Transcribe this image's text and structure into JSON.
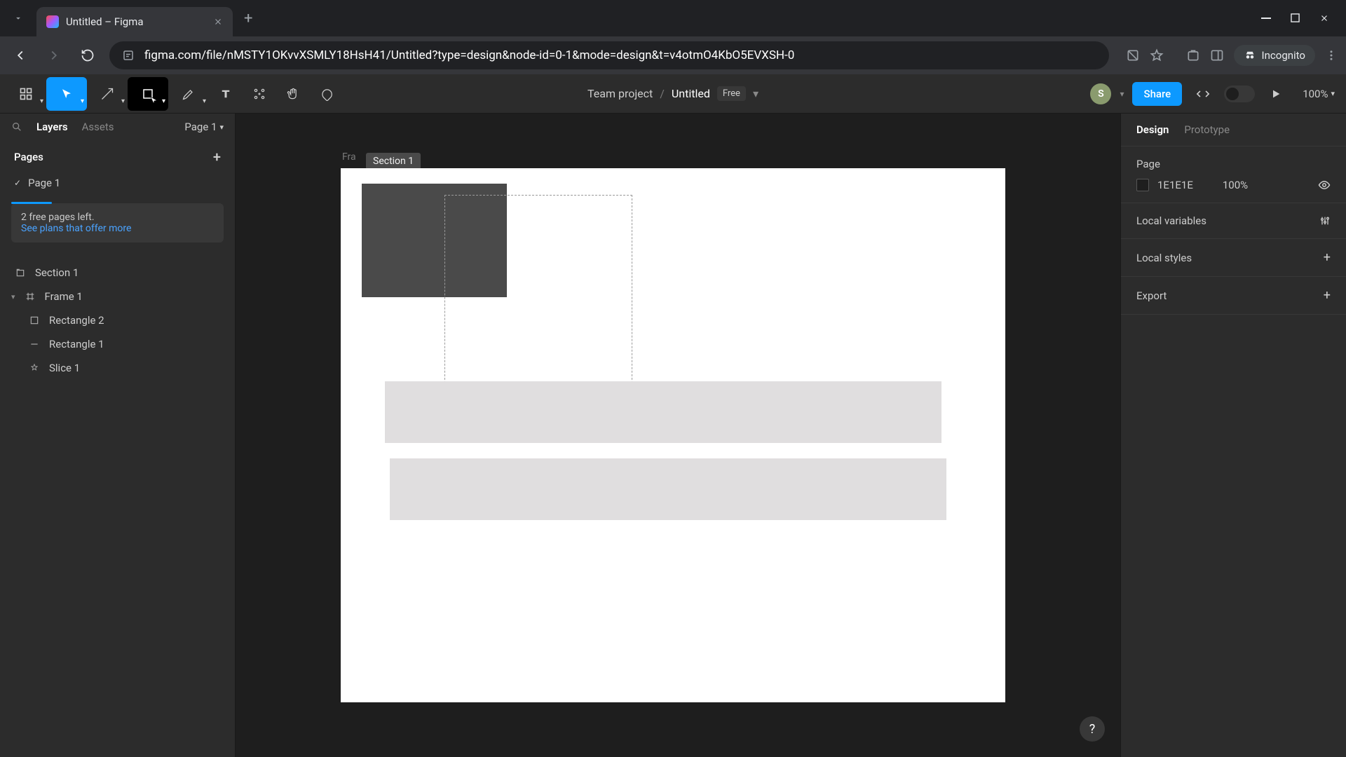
{
  "browser": {
    "tab_title": "Untitled – Figma",
    "url": "figma.com/file/nMSTY1OKvvXSMLY18HsH41/Untitled?type=design&node-id=0-1&mode=design&t=v4otmO4KbO5EVXSH-0",
    "incognito_label": "Incognito"
  },
  "toolbar": {
    "breadcrumb_team": "Team project",
    "breadcrumb_file": "Untitled",
    "plan_badge": "Free",
    "share_label": "Share",
    "avatar_initial": "S",
    "zoom": "100%"
  },
  "left_panel": {
    "tab_layers": "Layers",
    "tab_assets": "Assets",
    "page_selector": "Page 1",
    "pages_header": "Pages",
    "current_page": "Page 1",
    "upsell_line": "2 free pages left.",
    "upsell_link": "See plans that offer more",
    "layers": [
      {
        "name": "Section 1",
        "type": "section",
        "indent": 0
      },
      {
        "name": "Frame 1",
        "type": "frame",
        "indent": 0,
        "expanded": true
      },
      {
        "name": "Rectangle 2",
        "type": "rect",
        "indent": 1
      },
      {
        "name": "Rectangle 1",
        "type": "line",
        "indent": 1
      },
      {
        "name": "Slice 1",
        "type": "slice",
        "indent": 1
      }
    ]
  },
  "canvas": {
    "frame_label": "Fra",
    "section_label": "Section 1"
  },
  "right_panel": {
    "tab_design": "Design",
    "tab_prototype": "Prototype",
    "page_header": "Page",
    "page_color_hex": "1E1E1E",
    "page_color_opacity": "100%",
    "local_variables": "Local variables",
    "local_styles": "Local styles",
    "export": "Export"
  }
}
